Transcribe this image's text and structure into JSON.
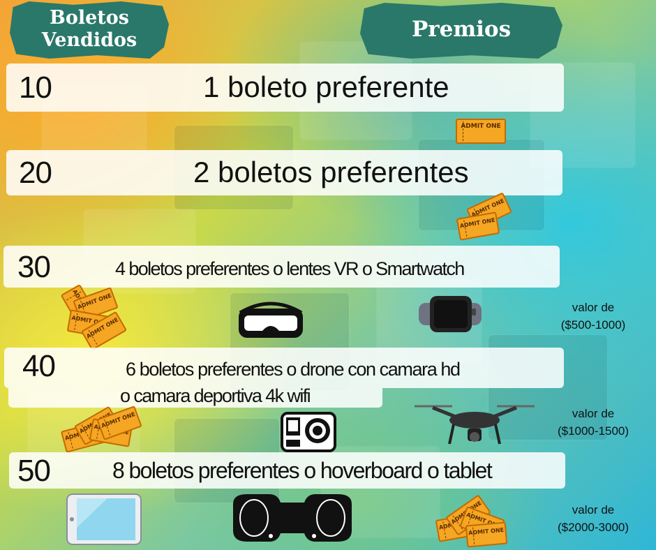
{
  "headers": {
    "sold_line1": "Boletos",
    "sold_line2": "Vendidos",
    "prizes": "Premios"
  },
  "tiers": [
    {
      "sold": "10",
      "prize": "1 boleto preferente"
    },
    {
      "sold": "20",
      "prize": "2 boletos preferentes"
    },
    {
      "sold": "30",
      "prize": "4 boletos  preferentes o lentes VR o Smartwatch",
      "value_label": "valor de",
      "value_range": "($500-1000)"
    },
    {
      "sold": "40",
      "prize_line1": "6 boletos  preferentes o drone con camara hd",
      "prize_line2": "o camara deportiva 4k wifi",
      "value_label": "valor de",
      "value_range": "($1000-1500)"
    },
    {
      "sold": "50",
      "prize": "8 boletos preferentes o hoverboard o tablet",
      "value_label": "valor de",
      "value_range": "($2000-3000)"
    }
  ],
  "ticket_text": "ADMIT ONE",
  "icons": [
    "ticket-icon",
    "vr-headset-icon",
    "smartwatch-icon",
    "action-camera-icon",
    "drone-icon",
    "tablet-icon",
    "hoverboard-icon"
  ],
  "colors": {
    "banner": "#2a786a",
    "ticket": "#f5a623"
  }
}
